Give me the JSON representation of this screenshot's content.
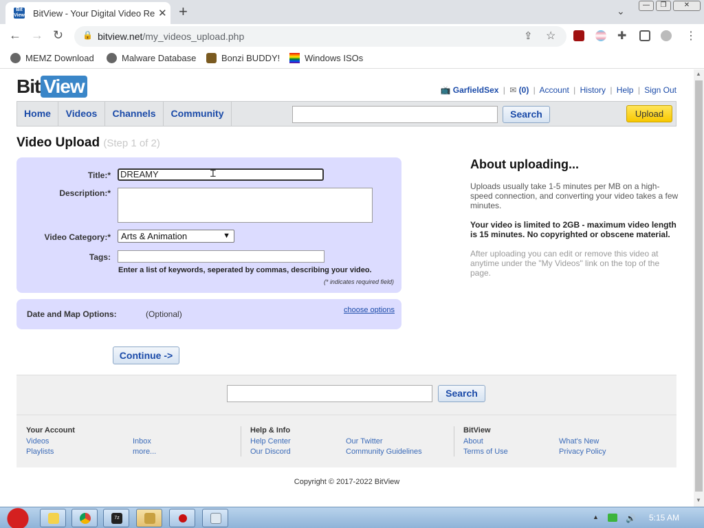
{
  "browser": {
    "tab_title": "BitView - Your Digital Video Re",
    "favicon_text": "Bit View",
    "url_domain": "bitview.net",
    "url_path": "/my_videos_upload.php",
    "bookmarks": [
      "MEMZ Download",
      "Malware Database",
      "Bonzi BUDDY!",
      "Windows ISOs"
    ]
  },
  "site": {
    "logo_bit": "Bit",
    "logo_view": "View",
    "user": {
      "username": "GarfieldSex",
      "inbox_count": "(0)",
      "links": [
        "Account",
        "History",
        "Help",
        "Sign Out"
      ]
    },
    "nav": {
      "tabs": [
        "Home",
        "Videos",
        "Channels",
        "Community"
      ],
      "search_label": "Search",
      "upload_label": "Upload"
    }
  },
  "upload": {
    "heading": "Video Upload",
    "step": "(Step 1 of 2)",
    "labels": {
      "title": "Title:*",
      "description": "Description:*",
      "category": "Video Category:*",
      "tags": "Tags:"
    },
    "title_value": "DREAMY",
    "description_value": "",
    "category_value": "Arts & Animation",
    "tags_value": "",
    "tags_hint": "Enter a list of keywords, seperated by commas, describing your video.",
    "required_note": "(* indicates required field)",
    "options_label": "Date and Map Options:",
    "options_optional": "(Optional)",
    "choose_options": "choose options",
    "continue_label": "Continue ->"
  },
  "about": {
    "heading": "About uploading...",
    "p1": "Uploads usually take 1-5 minutes per MB on a high-speed connection, and converting your video takes a few minutes.",
    "p2": "Your video is limited to 2GB - maximum video length is 15 minutes. No copyrighted or obscene material.",
    "p3": "After uploading you can edit or remove this video at anytime under the \"My Videos\" link on the top of the page."
  },
  "footer": {
    "search_label": "Search",
    "your_account": {
      "heading": "Your Account",
      "links": [
        "Videos",
        "Playlists",
        "Inbox",
        "more..."
      ]
    },
    "help_info": {
      "heading": "Help & Info",
      "links": [
        "Help Center",
        "Our Discord",
        "Our Twitter",
        "Community Guidelines"
      ]
    },
    "bitview": {
      "heading": "BitView",
      "links": [
        "About",
        "Terms of Use",
        "What's New",
        "Privacy Policy"
      ]
    },
    "copyright": "Copyright © 2017-2022 BitView"
  },
  "taskbar": {
    "clock": "5:15 AM"
  },
  "colors": {
    "link_blue": "#1a4aa8",
    "form_bg": "#dcdcff",
    "upload_yellow": "#f8c800",
    "logo_blue": "#3a86c8"
  }
}
